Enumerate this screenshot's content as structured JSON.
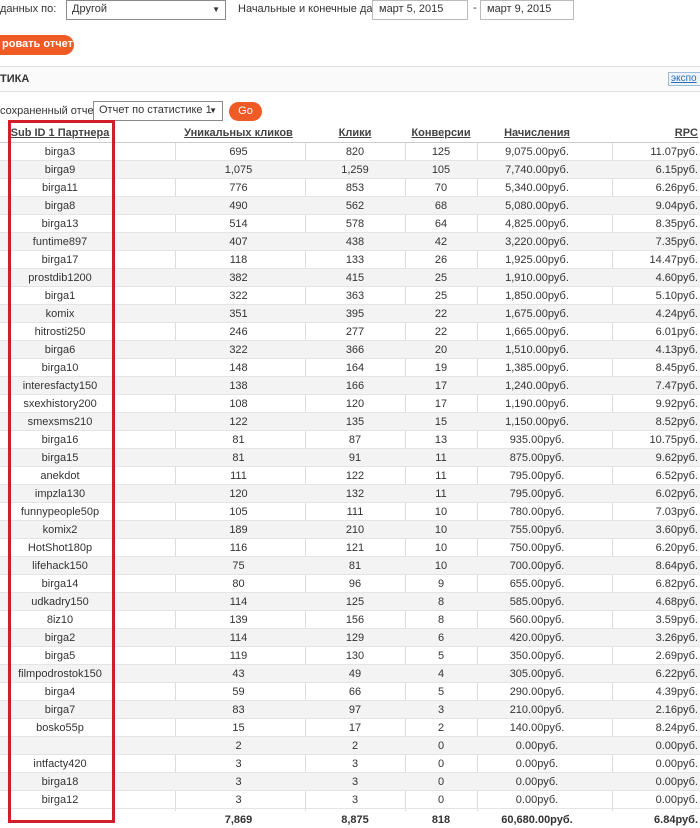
{
  "filters": {
    "source_label": "данных по:",
    "source_value": "Другой",
    "dates_label": "Начальные и конечные даты:",
    "date_from": "март 5, 2015",
    "date_sep": "-",
    "date_to": "март 9, 2015"
  },
  "generate_button": "ровать отчет",
  "section": {
    "title": "ТИКА",
    "export_label": "экспо"
  },
  "saved_report": {
    "label": "сохраненный отчет:",
    "value": "Отчет по статистике 1",
    "go_label": "Go"
  },
  "table": {
    "columns": [
      "Sub ID 1 Партнера",
      "Уникальных кликов",
      "Клики",
      "Конверсии",
      "Начисления",
      "RPC"
    ],
    "rows": [
      [
        "birga3",
        "695",
        "820",
        "125",
        "9,075.00руб.",
        "11.07руб."
      ],
      [
        "birga9",
        "1,075",
        "1,259",
        "105",
        "7,740.00руб.",
        "6.15руб."
      ],
      [
        "birga11",
        "776",
        "853",
        "70",
        "5,340.00руб.",
        "6.26руб."
      ],
      [
        "birga8",
        "490",
        "562",
        "68",
        "5,080.00руб.",
        "9.04руб."
      ],
      [
        "birga13",
        "514",
        "578",
        "64",
        "4,825.00руб.",
        "8.35руб."
      ],
      [
        "funtime897",
        "407",
        "438",
        "42",
        "3,220.00руб.",
        "7.35руб."
      ],
      [
        "birga17",
        "118",
        "133",
        "26",
        "1,925.00руб.",
        "14.47руб."
      ],
      [
        "prostdib1200",
        "382",
        "415",
        "25",
        "1,910.00руб.",
        "4.60руб."
      ],
      [
        "birga1",
        "322",
        "363",
        "25",
        "1,850.00руб.",
        "5.10руб."
      ],
      [
        "komix",
        "351",
        "395",
        "22",
        "1,675.00руб.",
        "4.24руб."
      ],
      [
        "hitrosti250",
        "246",
        "277",
        "22",
        "1,665.00руб.",
        "6.01руб."
      ],
      [
        "birga6",
        "322",
        "366",
        "20",
        "1,510.00руб.",
        "4.13руб."
      ],
      [
        "birga10",
        "148",
        "164",
        "19",
        "1,385.00руб.",
        "8.45руб."
      ],
      [
        "interesfacty150",
        "138",
        "166",
        "17",
        "1,240.00руб.",
        "7.47руб."
      ],
      [
        "sxexhistory200",
        "108",
        "120",
        "17",
        "1,190.00руб.",
        "9.92руб."
      ],
      [
        "smexsms210",
        "122",
        "135",
        "15",
        "1,150.00руб.",
        "8.52руб."
      ],
      [
        "birga16",
        "81",
        "87",
        "13",
        "935.00руб.",
        "10.75руб."
      ],
      [
        "birga15",
        "81",
        "91",
        "11",
        "875.00руб.",
        "9.62руб."
      ],
      [
        "anekdot",
        "111",
        "122",
        "11",
        "795.00руб.",
        "6.52руб."
      ],
      [
        "impzla130",
        "120",
        "132",
        "11",
        "795.00руб.",
        "6.02руб."
      ],
      [
        "funnypeople50p",
        "105",
        "111",
        "10",
        "780.00руб.",
        "7.03руб."
      ],
      [
        "komix2",
        "189",
        "210",
        "10",
        "755.00руб.",
        "3.60руб."
      ],
      [
        "HotShot180p",
        "116",
        "121",
        "10",
        "750.00руб.",
        "6.20руб."
      ],
      [
        "lifehack150",
        "75",
        "81",
        "10",
        "700.00руб.",
        "8.64руб."
      ],
      [
        "birga14",
        "80",
        "96",
        "9",
        "655.00руб.",
        "6.82руб."
      ],
      [
        "udkadry150",
        "114",
        "125",
        "8",
        "585.00руб.",
        "4.68руб."
      ],
      [
        "8iz10",
        "139",
        "156",
        "8",
        "560.00руб.",
        "3.59руб."
      ],
      [
        "birga2",
        "114",
        "129",
        "6",
        "420.00руб.",
        "3.26руб."
      ],
      [
        "birga5",
        "119",
        "130",
        "5",
        "350.00руб.",
        "2.69руб."
      ],
      [
        "filmpodrostok150",
        "43",
        "49",
        "4",
        "305.00руб.",
        "6.22руб."
      ],
      [
        "birga4",
        "59",
        "66",
        "5",
        "290.00руб.",
        "4.39руб."
      ],
      [
        "birga7",
        "83",
        "97",
        "3",
        "210.00руб.",
        "2.16руб."
      ],
      [
        "bosko55p",
        "15",
        "17",
        "2",
        "140.00руб.",
        "8.24руб."
      ],
      [
        "",
        "2",
        "2",
        "0",
        "0.00руб.",
        "0.00руб."
      ],
      [
        "intfacty420",
        "3",
        "3",
        "0",
        "0.00руб.",
        "0.00руб."
      ],
      [
        "birga18",
        "3",
        "3",
        "0",
        "0.00руб.",
        "0.00руб."
      ],
      [
        "birga12",
        "3",
        "3",
        "0",
        "0.00руб.",
        "0.00руб."
      ]
    ],
    "totals": [
      "",
      "7,869",
      "8,875",
      "818",
      "60,680.00руб.",
      "6.84руб."
    ]
  },
  "colors": {
    "accent": "#f05a24",
    "highlight": "#d21e2b",
    "link": "#2a6db3"
  }
}
